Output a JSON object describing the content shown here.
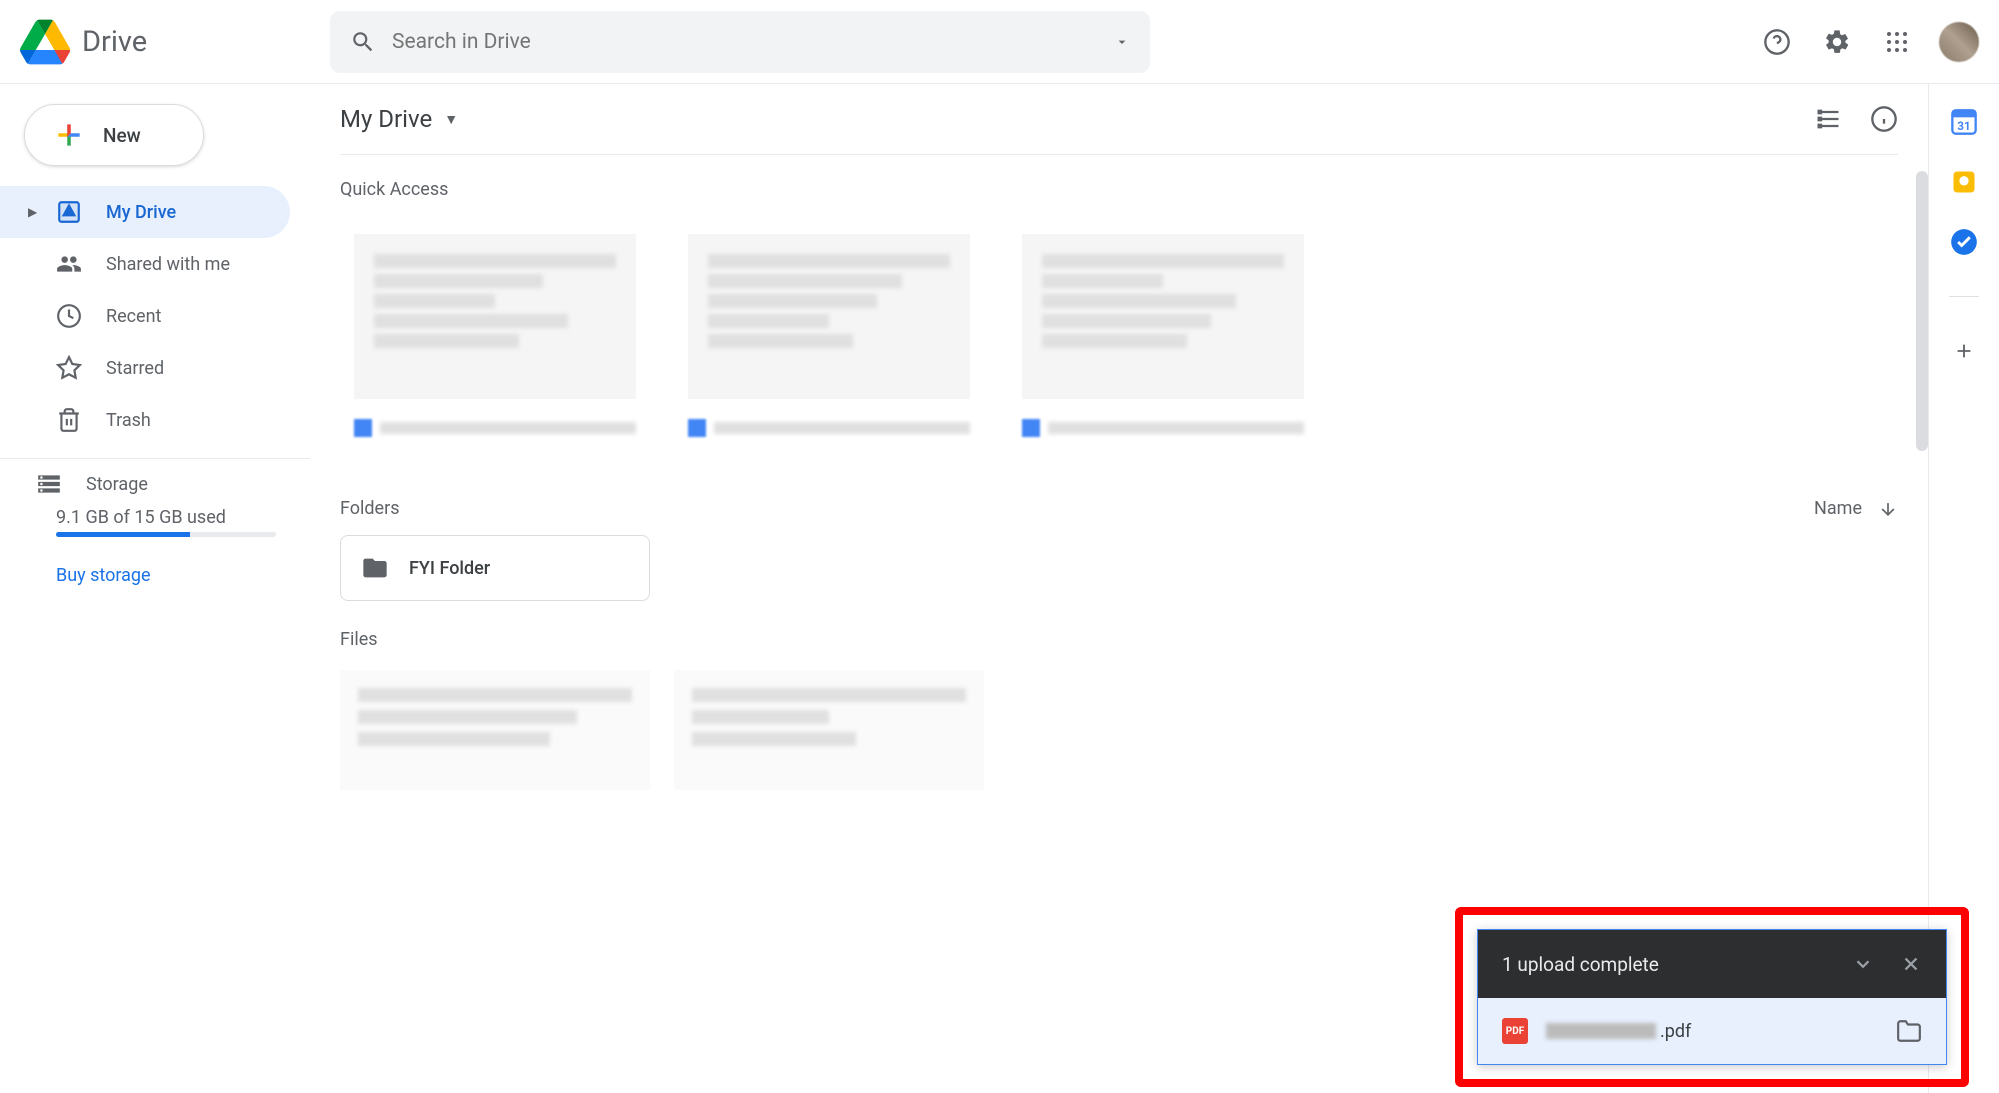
{
  "app": {
    "name": "Drive"
  },
  "search": {
    "placeholder": "Search in Drive"
  },
  "newButton": {
    "label": "New"
  },
  "sidebar": {
    "items": [
      {
        "label": "My Drive"
      },
      {
        "label": "Shared with me"
      },
      {
        "label": "Recent"
      },
      {
        "label": "Starred"
      },
      {
        "label": "Trash"
      }
    ],
    "storage": {
      "label": "Storage",
      "usage": "9.1 GB of 15 GB used",
      "buy": "Buy storage"
    }
  },
  "main": {
    "breadcrumb": "My Drive",
    "quickAccess": {
      "title": "Quick Access"
    },
    "foldersTitle": "Folders",
    "sortLabel": "Name",
    "folders": [
      {
        "name": "FYI Folder"
      }
    ],
    "filesTitle": "Files"
  },
  "toast": {
    "title": "1 upload complete",
    "file": {
      "ext": ".pdf",
      "iconText": "PDF"
    }
  },
  "rail": {
    "calendarDay": "31"
  }
}
